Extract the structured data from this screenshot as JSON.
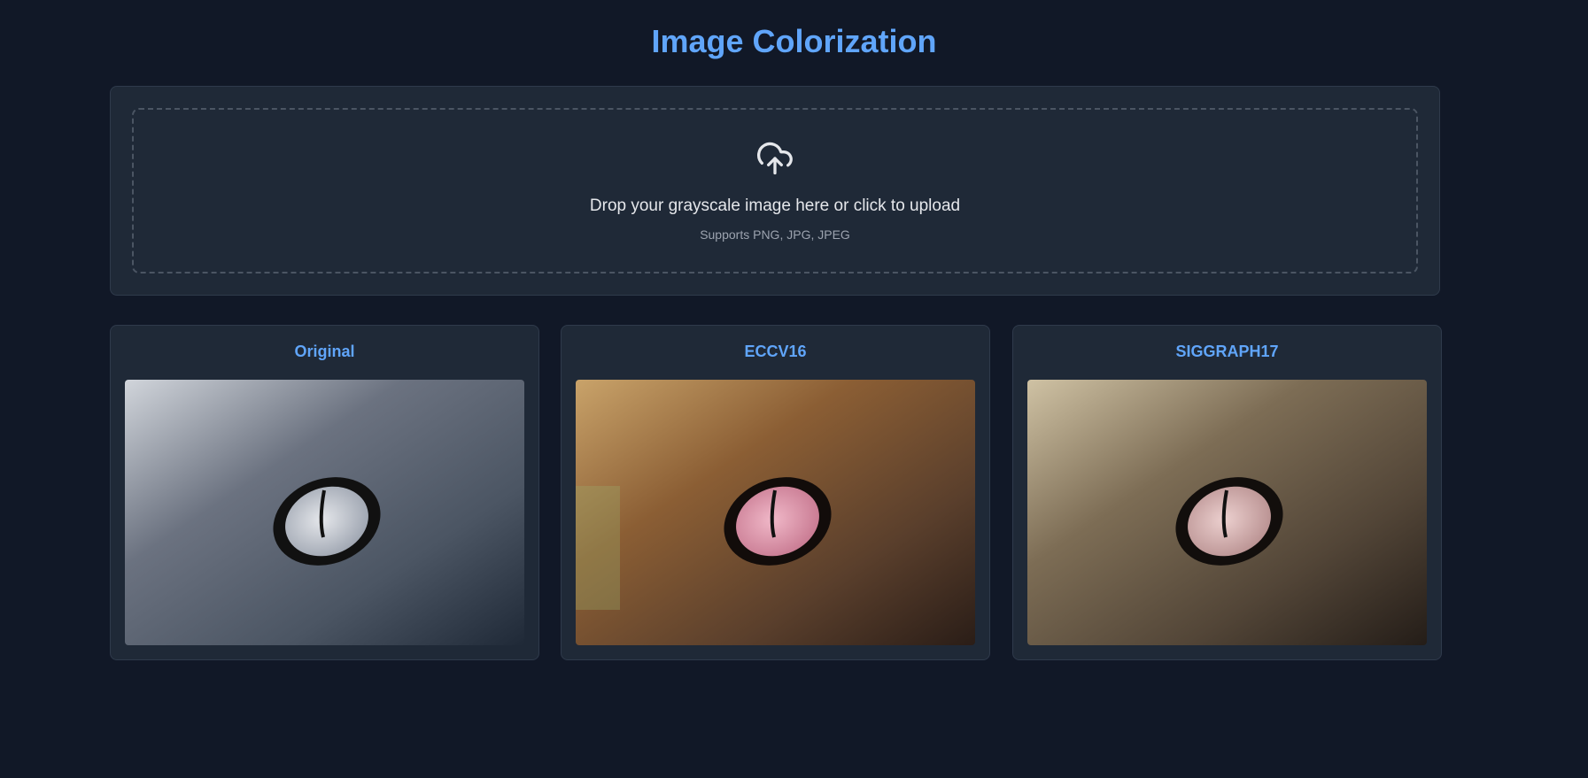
{
  "header": {
    "title": "Image Colorization"
  },
  "upload": {
    "icon": "cloud-upload-icon",
    "prompt": "Drop your grayscale image here or click to upload",
    "formats": "Supports PNG, JPG, JPEG"
  },
  "results": [
    {
      "title": "Original",
      "tint": "#9ca3af"
    },
    {
      "title": "ECCV16",
      "tint": "#b07a4a"
    },
    {
      "title": "SIGGRAPH17",
      "tint": "#8a7a63"
    }
  ],
  "colors": {
    "background": "#111827",
    "card": "#1f2937",
    "accent": "#60a5fa"
  }
}
